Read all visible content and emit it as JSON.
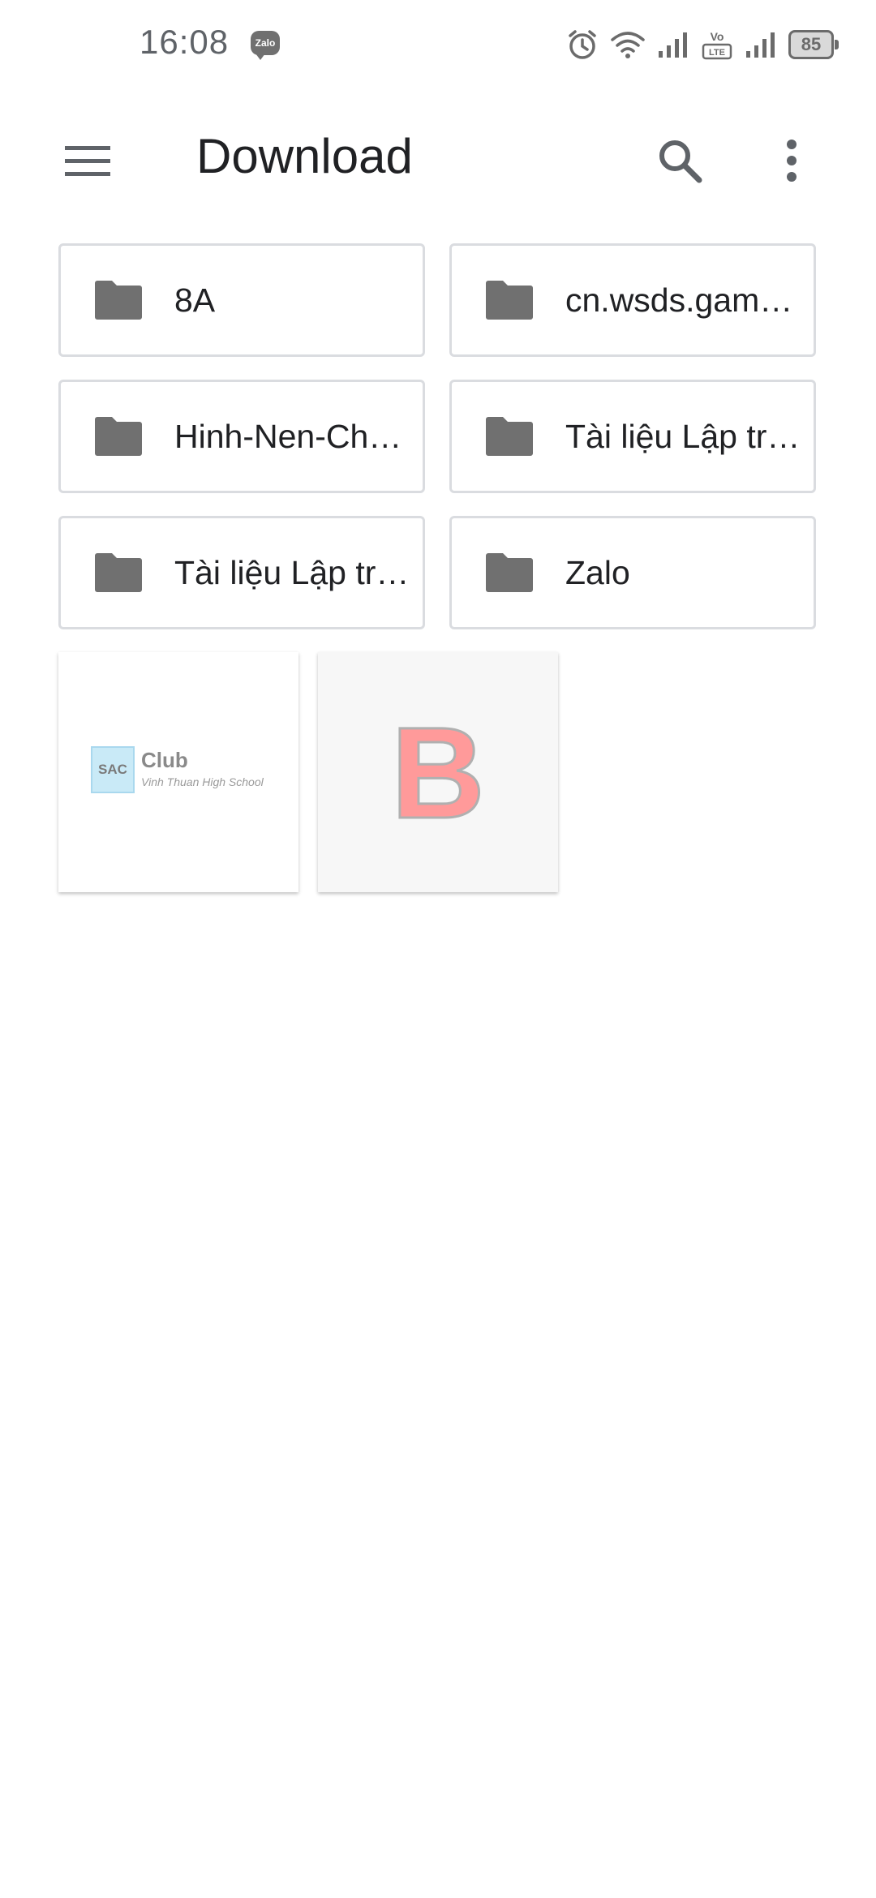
{
  "status_bar": {
    "time": "16:08",
    "notification_app": "Zalo",
    "network_badge_top": "Vo",
    "network_badge_bottom": "LTE",
    "battery": "85",
    "icons": [
      "alarm-icon",
      "wifi-icon",
      "signal-icon",
      "volte-icon",
      "signal-icon",
      "battery-icon"
    ]
  },
  "app_bar": {
    "title": "Download",
    "menu_icon": "hamburger-menu-icon",
    "search_icon": "search-icon",
    "more_icon": "more-vert-icon"
  },
  "folders": [
    {
      "name": "8A"
    },
    {
      "name": "cn.wsds.gam…"
    },
    {
      "name": "Hinh-Nen-Ch…"
    },
    {
      "name": "Tài liệu Lập tr…"
    },
    {
      "name": "Tài liệu Lập tr…"
    },
    {
      "name": "Zalo"
    }
  ],
  "files": [
    {
      "logo_box": "SAC",
      "logo_title": "Club",
      "logo_subtitle": "Vinh Thuan High School"
    },
    {
      "logo_letter": "B"
    }
  ],
  "colors": {
    "folder_icon": "#707070",
    "card_border": "#dadce0",
    "title_text": "#202124",
    "icon_gray": "#5f6368"
  }
}
